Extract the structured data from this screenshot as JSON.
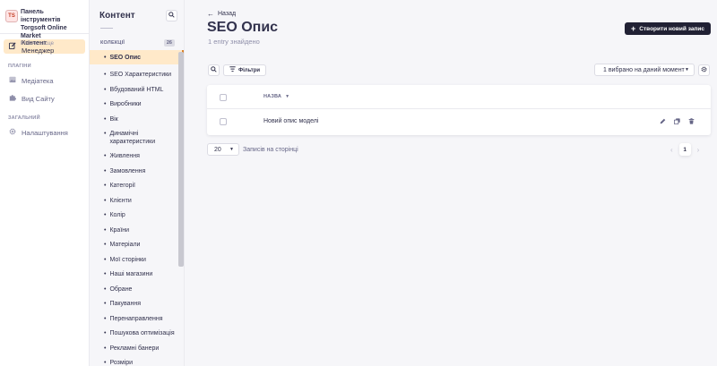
{
  "brand": {
    "logo_text": "TS",
    "title": "Панель інструментів Torgsoft Online Market",
    "subtitle": "Робоче місце"
  },
  "mainnav": {
    "active_item": "Контент Менеджер",
    "plugins_label": "ПЛАГІНИ",
    "plugins": [
      "Медіатека",
      "Вид Сайту"
    ],
    "general_label": "ЗАГАЛЬНИЙ",
    "general": [
      "Налаштування"
    ]
  },
  "subnav": {
    "title": "Контент",
    "collections_label": "КОЛЕКЦІЇ",
    "collections_count": "26",
    "items": [
      "SEO Опис",
      "SEO Характеристики",
      "Вбудований HTML",
      "Виробники",
      "Вік",
      "Динамічні характеристики",
      "Живлення",
      "Замовлення",
      "Категорії",
      "Клієнти",
      "Колір",
      "Країни",
      "Матеріали",
      "Мої сторінки",
      "Наші магазини",
      "Обране",
      "Пакування",
      "Перенаправлення",
      "Пошукова оптимізація",
      "Рекламні банери",
      "Розміри"
    ]
  },
  "main": {
    "back_label": "Назад",
    "title": "SEO Опис",
    "entries_found": "1 entry знайдено",
    "create_label": "Створити новий запис",
    "filters_label": "Фільтри",
    "columns_select": "1 вибрано на даний момент",
    "table": {
      "name_header": "НАЗВА",
      "rows": [
        {
          "name": "Новий опис моделі"
        }
      ]
    },
    "page_size": "20",
    "page_size_label": "Записів на сторінці",
    "current_page": "1"
  },
  "colors": {
    "active_bg": "#ffe9c9",
    "active_accent": "#d9822b",
    "primary_dark": "#212134",
    "brand_red": "#c23b22"
  }
}
